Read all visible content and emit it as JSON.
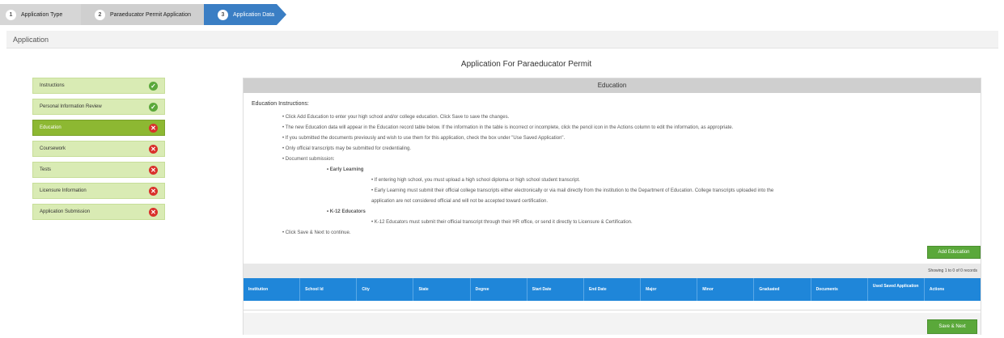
{
  "wizard": {
    "steps": [
      {
        "num": "1",
        "label": "Application Type"
      },
      {
        "num": "2",
        "label": "Paraeducator Permit Application"
      },
      {
        "num": "3",
        "label": "Application Data"
      }
    ]
  },
  "app_bar": {
    "title": "Application"
  },
  "page_title": "Application For Paraeducator Permit",
  "menu": [
    {
      "label": "Instructions",
      "status": "✓"
    },
    {
      "label": "Personal Information Review",
      "status": "✓"
    },
    {
      "label": "Education",
      "status": "✕"
    },
    {
      "label": "Coursework",
      "status": "✕"
    },
    {
      "label": "Tests",
      "status": "✕"
    },
    {
      "label": "Licensure Information",
      "status": "✕"
    },
    {
      "label": "Application Submission",
      "status": "✕"
    }
  ],
  "panel": {
    "title": "Education",
    "instructions_title": "Education Instructions:",
    "instructions": [
      "• Click Add Education to enter your high school and/or college education. Click Save to save the changes.",
      "• The new Education data will appear in the Education record table below. If the information in the table is incorrect or incomplete, click the pencil icon in the Actions column to edit the information, as appropriate.",
      "• If you submitted the documents previously and wish to use them for this application, check the box under \"Use Saved Application\".",
      "• Only official transcripts may be submitted for credentialing.",
      "• Document submission:"
    ],
    "early_learning_label": "• Early Learning",
    "early_learning_items": [
      "• If entering high school, you must upload a high school diploma or high school student transcript.",
      "• Early Learning must submit their official college transcripts either electronically or via mail directly from the institution to the Department of Education. College transcripts uploaded into the",
      "application are not considered official and will not be accepted toward certification."
    ],
    "k12_label": "• K-12 Educators",
    "k12_items": [
      "• K-12 Educators must submit their official transcript through their HR office, or send it directly to Licensure & Certification."
    ],
    "final_instruction": "• Click Save & Next to continue.",
    "add_button": "Add Education",
    "showing_text": "Showing 1 to 0 of 0 records",
    "columns": [
      "Institution",
      "School Id",
      "City",
      "State",
      "Degree",
      "Start Date",
      "End Date",
      "Major",
      "Minor",
      "Graduated",
      "Documents",
      "Used Saved Application",
      "Actions"
    ],
    "save_button": "Save & Next"
  }
}
